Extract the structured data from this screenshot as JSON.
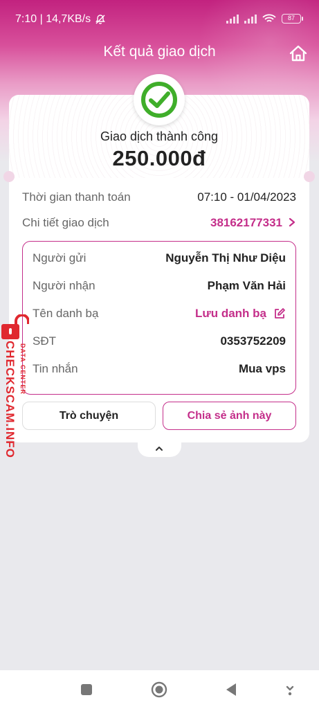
{
  "status_bar": {
    "time_speed": "7:10 | 14,7KB/s",
    "battery": "87"
  },
  "header": {
    "title": "Kết quả giao dịch"
  },
  "result": {
    "status": "Giao dịch thành công",
    "amount": "250.000đ"
  },
  "info": {
    "time_label": "Thời gian thanh toán",
    "time_value": "07:10 - 01/04/2023",
    "detail_label": "Chi tiết giao dịch",
    "detail_value": "38162177331"
  },
  "details": {
    "sender_label": "Người gửi",
    "sender_value": "Nguyễn Thị Như Diệu",
    "receiver_label": "Người nhận",
    "receiver_value": "Phạm Văn Hải",
    "contact_label": "Tên danh bạ",
    "contact_value": "Lưu danh bạ",
    "phone_label": "SĐT",
    "phone_value": "0353752209",
    "message_label": "Tin nhắn",
    "message_value": "Mua vps"
  },
  "actions": {
    "chat_label": "Trò chuyện",
    "share_label": "Chia sẻ ảnh này"
  },
  "watermark": {
    "main": "CHECKSCAM.INFO",
    "sub": "DATA CENTER"
  },
  "colors": {
    "brand": "#c42e8a",
    "success": "#3fae2a",
    "watermark": "#e0282f"
  }
}
